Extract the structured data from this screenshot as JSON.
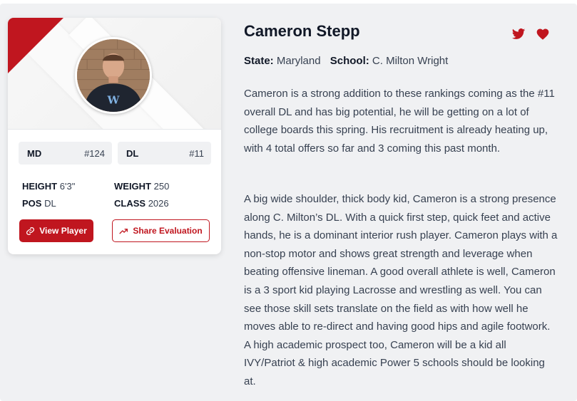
{
  "player": {
    "name": "Cameron Stepp",
    "state_label": "State:",
    "state": "Maryland",
    "school_label": "School:",
    "school": "C. Milton Wright"
  },
  "rankings": {
    "state": {
      "label": "MD",
      "rank": "#124"
    },
    "position": {
      "label": "DL",
      "rank": "#11"
    }
  },
  "attributes": {
    "height_label": "HEIGHT",
    "height": "6'3\"",
    "weight_label": "WEIGHT",
    "weight": "250",
    "pos_label": "POS",
    "pos": "DL",
    "class_label": "CLASS",
    "class": "2026"
  },
  "actions": {
    "view_player": "View Player",
    "share_evaluation": "Share Evaluation"
  },
  "icons": {
    "twitter": "twitter-icon",
    "favorite": "heart-icon",
    "link": "link-icon",
    "trend": "trending-up-icon"
  },
  "colors": {
    "accent": "#c0161f",
    "background": "#f0f1f3"
  },
  "evaluation": {
    "paragraph1": "Cameron is a strong addition to these rankings coming as the #11 overall DL and has big potential, he will be getting on a lot of college boards this spring. His recruitment is already heating up, with 4 total offers so far and 3 coming this past month.",
    "paragraph2": "A big wide shoulder, thick body kid, Cameron is a strong presence along C. Milton’s DL. With a quick first step, quick feet and active hands, he is a dominant interior rush player. Cameron plays with a non-stop motor and shows great strength and leverage when beating offensive lineman. A good overall athlete is well, Cameron is a 3 sport kid playing Lacrosse and wrestling as well. You can see those skill sets translate on the field as with how well he moves able to re-direct and having good hips and agile footwork. A high academic prospect too, Cameron will be a kid all IVY/Patriot & high academic Power 5 schools should be looking at."
  }
}
